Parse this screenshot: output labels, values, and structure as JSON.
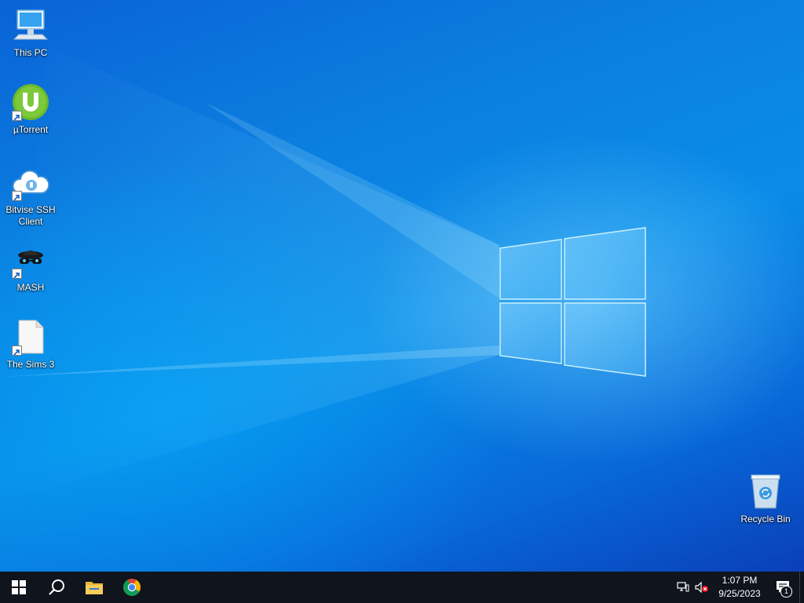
{
  "desktop": {
    "icons": [
      {
        "label": "This PC",
        "icon": "computer-icon",
        "shortcut": false
      },
      {
        "label": "µTorrent",
        "icon": "utorrent-icon",
        "shortcut": true
      },
      {
        "label": "Bitvise SSH Client",
        "icon": "bitvise-cloud-icon",
        "shortcut": true
      },
      {
        "label": "MASH",
        "icon": "mash-spy-icon",
        "shortcut": true
      },
      {
        "label": "The Sims 3",
        "icon": "blank-file-icon",
        "shortcut": true
      },
      {
        "label": "Recycle Bin",
        "icon": "recycle-bin-icon",
        "shortcut": false
      }
    ]
  },
  "taskbar": {
    "buttons": [
      {
        "name": "start",
        "icon": "windows-logo-icon"
      },
      {
        "name": "search",
        "icon": "search-icon"
      },
      {
        "name": "file-explorer",
        "icon": "folder-icon"
      },
      {
        "name": "chrome",
        "icon": "chrome-icon"
      }
    ],
    "tray": {
      "network_icon": "network-icon",
      "volume_icon": "volume-muted-icon",
      "time": "1:07 PM",
      "date": "9/25/2023",
      "notification_icon": "action-center-icon",
      "notification_count": "1"
    }
  },
  "colors": {
    "taskbar": "#0f141d",
    "wallpaper_accent": "#0a8ce8",
    "logo_glow": "#9fdcff"
  }
}
